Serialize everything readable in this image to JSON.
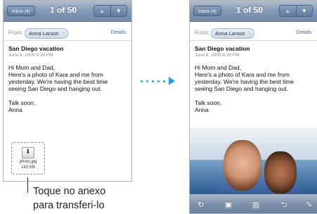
{
  "left_phone": {
    "navbar": {
      "back_label": "Inbox (4)",
      "counter": "1 of 50",
      "up_arrow": "▲",
      "down_arrow": "▼"
    },
    "from": {
      "label": "From:",
      "sender": "Anna Larson",
      "chevron": "›",
      "details": "Details"
    },
    "message": {
      "subject": "San Diego vacation",
      "date": "June 8, 2009 6:39 PM",
      "body": [
        "Hi Mom and Dad,",
        "Here's a photo of Kara and me from",
        "yesterday. We're having the best time",
        "seeing San Diego and hanging out.",
        "",
        "Talk soon,",
        "Anna"
      ]
    },
    "attachment": {
      "name": "photo.jpg",
      "size": "142 KB",
      "icon": "download-icon"
    }
  },
  "caption": {
    "line1": "Toque no anexo",
    "line2": "para transferi-lo"
  },
  "right_phone": {
    "navbar": {
      "back_label": "Inbox (4)",
      "counter": "1 of 50",
      "up_arrow": "▲",
      "down_arrow": "▼"
    },
    "from": {
      "label": "From:",
      "sender": "Anna Larson",
      "chevron": "›",
      "details": "Details"
    },
    "message": {
      "subject": "San Diego vacation",
      "date": "June 8, 2009 6:39 PM",
      "body": [
        "Hi Mom and Dad,",
        "Here's a photo of Kara and me from",
        "yesterday. We're having the best time",
        "seeing San Diego and hanging out.",
        "",
        "Talk soon,",
        "Anna"
      ]
    },
    "toolbar": {
      "icons": [
        "refresh-icon",
        "move-folder-icon",
        "trash-icon",
        "reply-icon",
        "compose-icon"
      ],
      "glyphs": [
        "↻",
        "▣",
        "▥",
        "⮌",
        "✎"
      ]
    }
  },
  "colors": {
    "accent_arrow": "#2a9fdb",
    "navbar": "#7389a7",
    "link": "#3769b8"
  }
}
